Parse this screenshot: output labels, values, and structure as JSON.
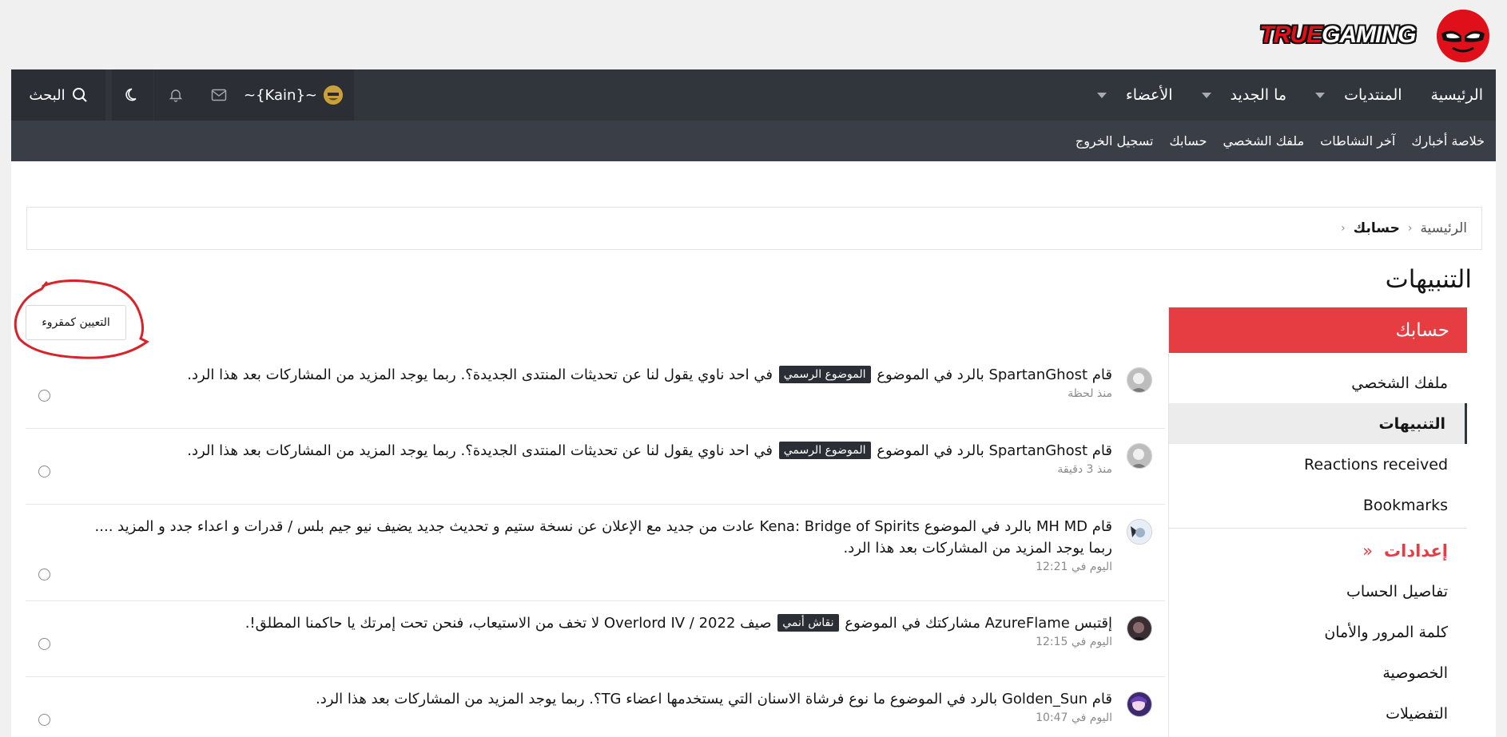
{
  "header": {
    "logo_text_prefix": "TRUE",
    "logo_text_suffix": "GAMING",
    "brand_red": "#e0101b"
  },
  "nav": {
    "items": [
      {
        "label": "الرئيسية",
        "has_dropdown": false
      },
      {
        "label": "المنتديات",
        "has_dropdown": true
      },
      {
        "label": "ما الجديد",
        "has_dropdown": true
      },
      {
        "label": "الأعضاء",
        "has_dropdown": true
      }
    ],
    "username": "~{Kain}~",
    "search_label": "البحث",
    "icons": [
      "mail-icon",
      "bell-icon",
      "moon-icon",
      "search-icon"
    ]
  },
  "subnav": {
    "items": [
      "خلاصة أخبارك",
      "آخر النشاطات",
      "ملفك الشخصي",
      "حسابك",
      "تسجيل الخروج"
    ]
  },
  "breadcrumb": {
    "home": "الرئيسية",
    "current": "حسابك"
  },
  "page": {
    "title": "التنبيهات"
  },
  "sidebar": {
    "header": "حسابك",
    "items": [
      {
        "label": "ملفك الشخصي"
      },
      {
        "label": "التنبيهات"
      },
      {
        "label": "Reactions received"
      },
      {
        "label": "Bookmarks"
      }
    ],
    "settings_header": "إعدادات",
    "settings_arrow": "«",
    "settings_items": [
      {
        "label": "تفاصيل الحساب"
      },
      {
        "label": "كلمة المرور والأمان"
      },
      {
        "label": "الخصوصية"
      },
      {
        "label": "التفضيلات"
      }
    ],
    "accent_color": "#e53d42"
  },
  "alerts": {
    "mark_read_label": "التعيين كمقروء",
    "items": [
      {
        "prefix": "قام ",
        "user": "SpartanGhost",
        "action": " بالرد في الموضوع ",
        "label": "الموضوع الرسمي",
        "thread": " في احد ناوي يقول لنا عن تحديثات المنتدى الجديدة؟",
        "suffix": ". ربما يوجد المزيد من المشاركات بعد هذا الرد.",
        "time": "منذ لحظة"
      },
      {
        "prefix": "قام ",
        "user": "SpartanGhost",
        "action": " بالرد في الموضوع ",
        "label": "الموضوع الرسمي",
        "thread": " في احد ناوي يقول لنا عن تحديثات المنتدى الجديدة؟",
        "suffix": ". ربما يوجد المزيد من المشاركات بعد هذا الرد.",
        "time": "منذ 3 دقيقة"
      },
      {
        "prefix": "قام ",
        "user": "MH MD",
        "action": " بالرد في الموضوع ",
        "label": "",
        "thread": "Kena: Bridge of Spirits عادت من جديد مع الإعلان عن نسخة ستيم و تحديث جديد يضيف نيو جيم بلس / قدرات و اعداء جدد و المزيد ....",
        "suffix": " ربما يوجد المزيد من المشاركات بعد هذا الرد.",
        "time": "اليوم في 12:21"
      },
      {
        "prefix": "إقتبس ",
        "user": "AzureFlame",
        "action": " مشاركتك في الموضوع ",
        "label": "نقاش أنمي",
        "thread": " صيف 2022 / Overlord IV لا تخف من الاستيعاب، فنحن تحت إمرتك يا حاكمنا المطلق!",
        "suffix": ".",
        "time": "اليوم في 12:15"
      },
      {
        "prefix": "قام ",
        "user": "Golden_Sun",
        "action": " بالرد في الموضوع ",
        "label": "",
        "thread": "ما نوع فرشاة الاسنان التي يستخدمها اعضاء TG؟",
        "suffix": ". ربما يوجد المزيد من المشاركات بعد هذا الرد.",
        "time": "اليوم في 10:47"
      }
    ]
  }
}
